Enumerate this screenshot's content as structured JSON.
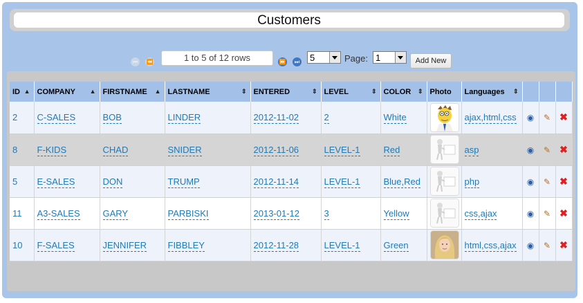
{
  "title": "Customers",
  "pager": {
    "rows_text": "1 to 5 of 12 rows",
    "per_page": "5",
    "page_label": "Page:",
    "page_value": "1",
    "add_new": "Add New"
  },
  "columns": [
    "ID",
    "COMPANY",
    "FIRSTNAME",
    "LASTNAME",
    "ENTERED",
    "LEVEL",
    "COLOR",
    "Photo",
    "Languages"
  ],
  "rows": [
    {
      "id": "2",
      "company": "C-SALES",
      "first": "BOB",
      "last": "LINDER",
      "entered": "2012-11-02",
      "level": "2",
      "color": "White",
      "photo": "cartoon",
      "lang": "ajax,html,css"
    },
    {
      "id": "8",
      "company": "F-KIDS",
      "first": "CHAD",
      "last": "SNIDER",
      "entered": "2012-11-06",
      "level": "LEVEL-1",
      "color": "Red",
      "photo": "placeholder",
      "lang": "asp"
    },
    {
      "id": "5",
      "company": "E-SALES",
      "first": "DON",
      "last": "TRUMP",
      "entered": "2012-11-14",
      "level": "LEVEL-1",
      "color": "Blue,Red",
      "photo": "placeholder",
      "lang": "php"
    },
    {
      "id": "11",
      "company": "A3-SALES",
      "first": "GARY",
      "last": "PARBISKI",
      "entered": "2013-01-12",
      "level": "3",
      "color": "Yellow",
      "photo": "placeholder",
      "lang": "css,ajax"
    },
    {
      "id": "10",
      "company": "F-SALES",
      "first": "JENNIFER",
      "last": "FIBBLEY",
      "entered": "2012-11-28",
      "level": "LEVEL-1",
      "color": "Green",
      "photo": "woman",
      "lang": "html,css,ajax"
    }
  ]
}
